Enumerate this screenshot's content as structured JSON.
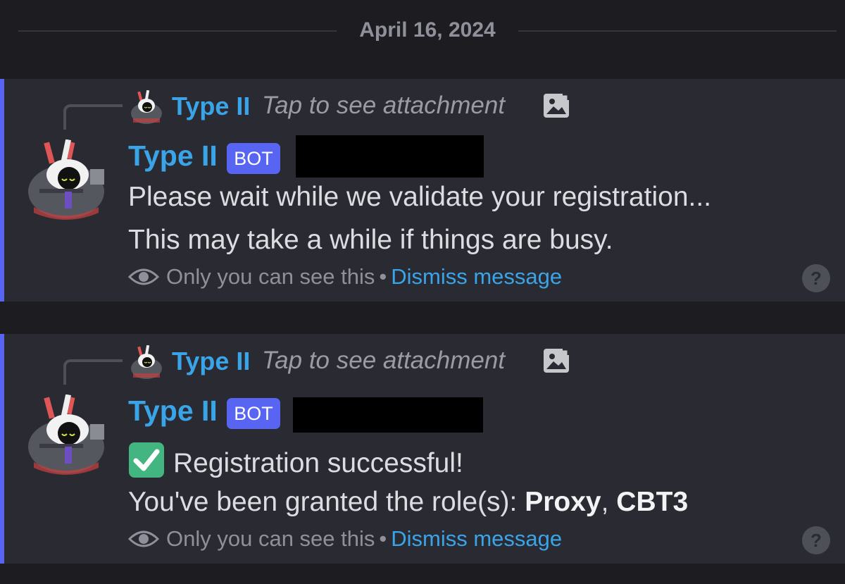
{
  "date_divider": "April 16, 2024",
  "messages": [
    {
      "reply": {
        "author": "Type II",
        "text": "Tap to see attachment",
        "icon": "image-icon"
      },
      "author": "Type II",
      "badge": "BOT",
      "lines": [
        "Please wait while we validate your registration...",
        "This may take a while if things are busy."
      ],
      "ephemeral": {
        "notice": "Only you can see this",
        "separator": "•",
        "dismiss": "Dismiss message"
      }
    },
    {
      "reply": {
        "author": "Type II",
        "text": "Tap to see attachment",
        "icon": "image-icon"
      },
      "author": "Type II",
      "badge": "BOT",
      "line1_text": "Registration successful!",
      "line2_prefix": "You've been granted the role(s): ",
      "role1": "Proxy",
      "role_sep": ", ",
      "role2": "CBT3",
      "ephemeral": {
        "notice": "Only you can see this",
        "separator": "•",
        "dismiss": "Dismiss message"
      }
    }
  ],
  "colors": {
    "background": "#1c1c21",
    "card": "#2a2b32",
    "accent": "#5865f2",
    "name": "#3aa4e8",
    "text": "#dcdde2",
    "muted": "#8f909a",
    "success": "#43b581"
  }
}
